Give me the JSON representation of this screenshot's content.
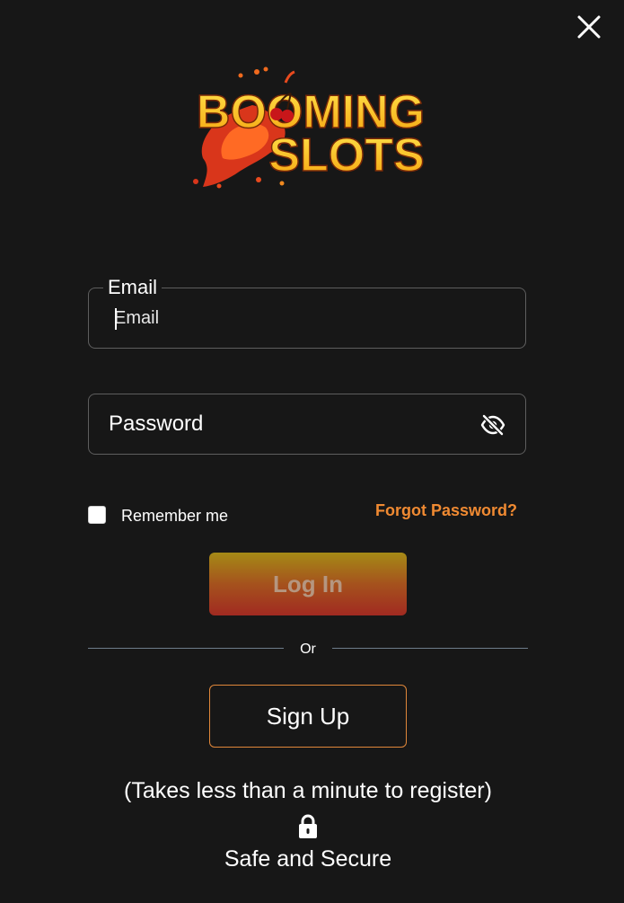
{
  "logo": {
    "line1": "BOOMING",
    "line2": "SLOTS"
  },
  "email": {
    "legend": "Email",
    "placeholder": "Email",
    "value": ""
  },
  "password": {
    "placeholder": "Password",
    "value": ""
  },
  "remember_label": "Remember me",
  "forgot_label": "Forgot Password?",
  "login_label": "Log In",
  "divider_text": "Or",
  "signup_label": "Sign Up",
  "register_note": "(Takes less than a minute to register)",
  "secure_text": "Safe and Secure",
  "icons": {
    "close": "close-icon",
    "eye": "eye-off-icon",
    "lock": "lock-icon"
  },
  "colors": {
    "background": "#171717",
    "accent": "#f08a32",
    "login_gradient_top": "#a58a16",
    "login_gradient_bottom": "#a12a21",
    "field_border": "#5e5e5e"
  }
}
